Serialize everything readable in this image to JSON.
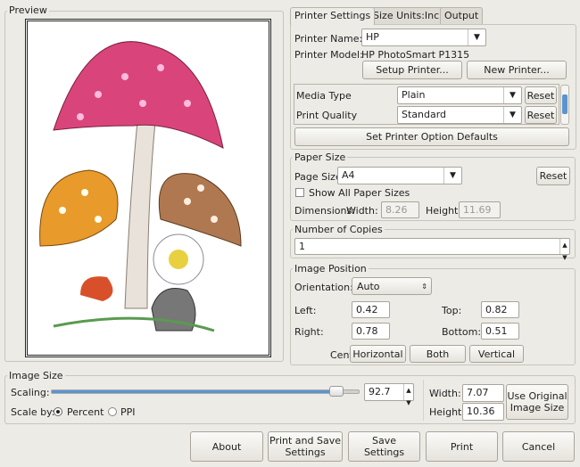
{
  "preview": {
    "title": "Preview"
  },
  "tabs": [
    {
      "label": "Printer Settings",
      "active": true
    },
    {
      "label": "Size Units:Inch"
    },
    {
      "label": "Output"
    }
  ],
  "printer": {
    "name_label": "Printer Name:",
    "name_value": "HP",
    "model_label": "Printer Model:",
    "model_value": "HP PhotoSmart P1315",
    "setup_button": "Setup Printer...",
    "new_button": "New Printer...",
    "options": [
      {
        "label": "Media Type",
        "value": "Plain",
        "reset": "Reset"
      },
      {
        "label": "Print Quality",
        "value": "Standard",
        "reset": "Reset"
      }
    ],
    "defaults_button": "Set Printer Option Defaults"
  },
  "paper": {
    "title": "Paper Size",
    "page_size_label": "Page Size",
    "page_size_value": "A4",
    "reset": "Reset",
    "show_all_label": "Show All Paper Sizes",
    "show_all_checked": false,
    "dimensions_label": "Dimensions:",
    "width_label": "Width:",
    "width_value": "8.26",
    "height_label": "Height:",
    "height_value": "11.69"
  },
  "copies": {
    "title": "Number of Copies",
    "value": "1"
  },
  "position": {
    "title": "Image Position",
    "orientation_label": "Orientation:",
    "orientation_value": "Auto",
    "left_label": "Left:",
    "left_value": "0.42",
    "top_label": "Top:",
    "top_value": "0.82",
    "right_label": "Right:",
    "right_value": "0.78",
    "bottom_label": "Bottom:",
    "bottom_value": "0.51",
    "center_label": "Center:",
    "horizontal": "Horizontal",
    "both": "Both",
    "vertical": "Vertical"
  },
  "image_size": {
    "title": "Image Size",
    "scaling_label": "Scaling:",
    "scaling_value": "92.7",
    "scaling_percent": 92.7,
    "scale_by_label": "Scale by:",
    "percent_label": "Percent",
    "ppi_label": "PPI",
    "scale_by_selected": "Percent",
    "width_label": "Width:",
    "width_value": "7.07",
    "height_label": "Height:",
    "height_value": "10.36",
    "original_button": "Use Original Image Size"
  },
  "buttons": {
    "about": "About",
    "print_save": "Print and Save Settings",
    "save": "Save Settings",
    "print": "Print",
    "cancel": "Cancel"
  },
  "colors": {
    "slider_fill": "#5a94d0",
    "accent": "#5a94d0"
  }
}
